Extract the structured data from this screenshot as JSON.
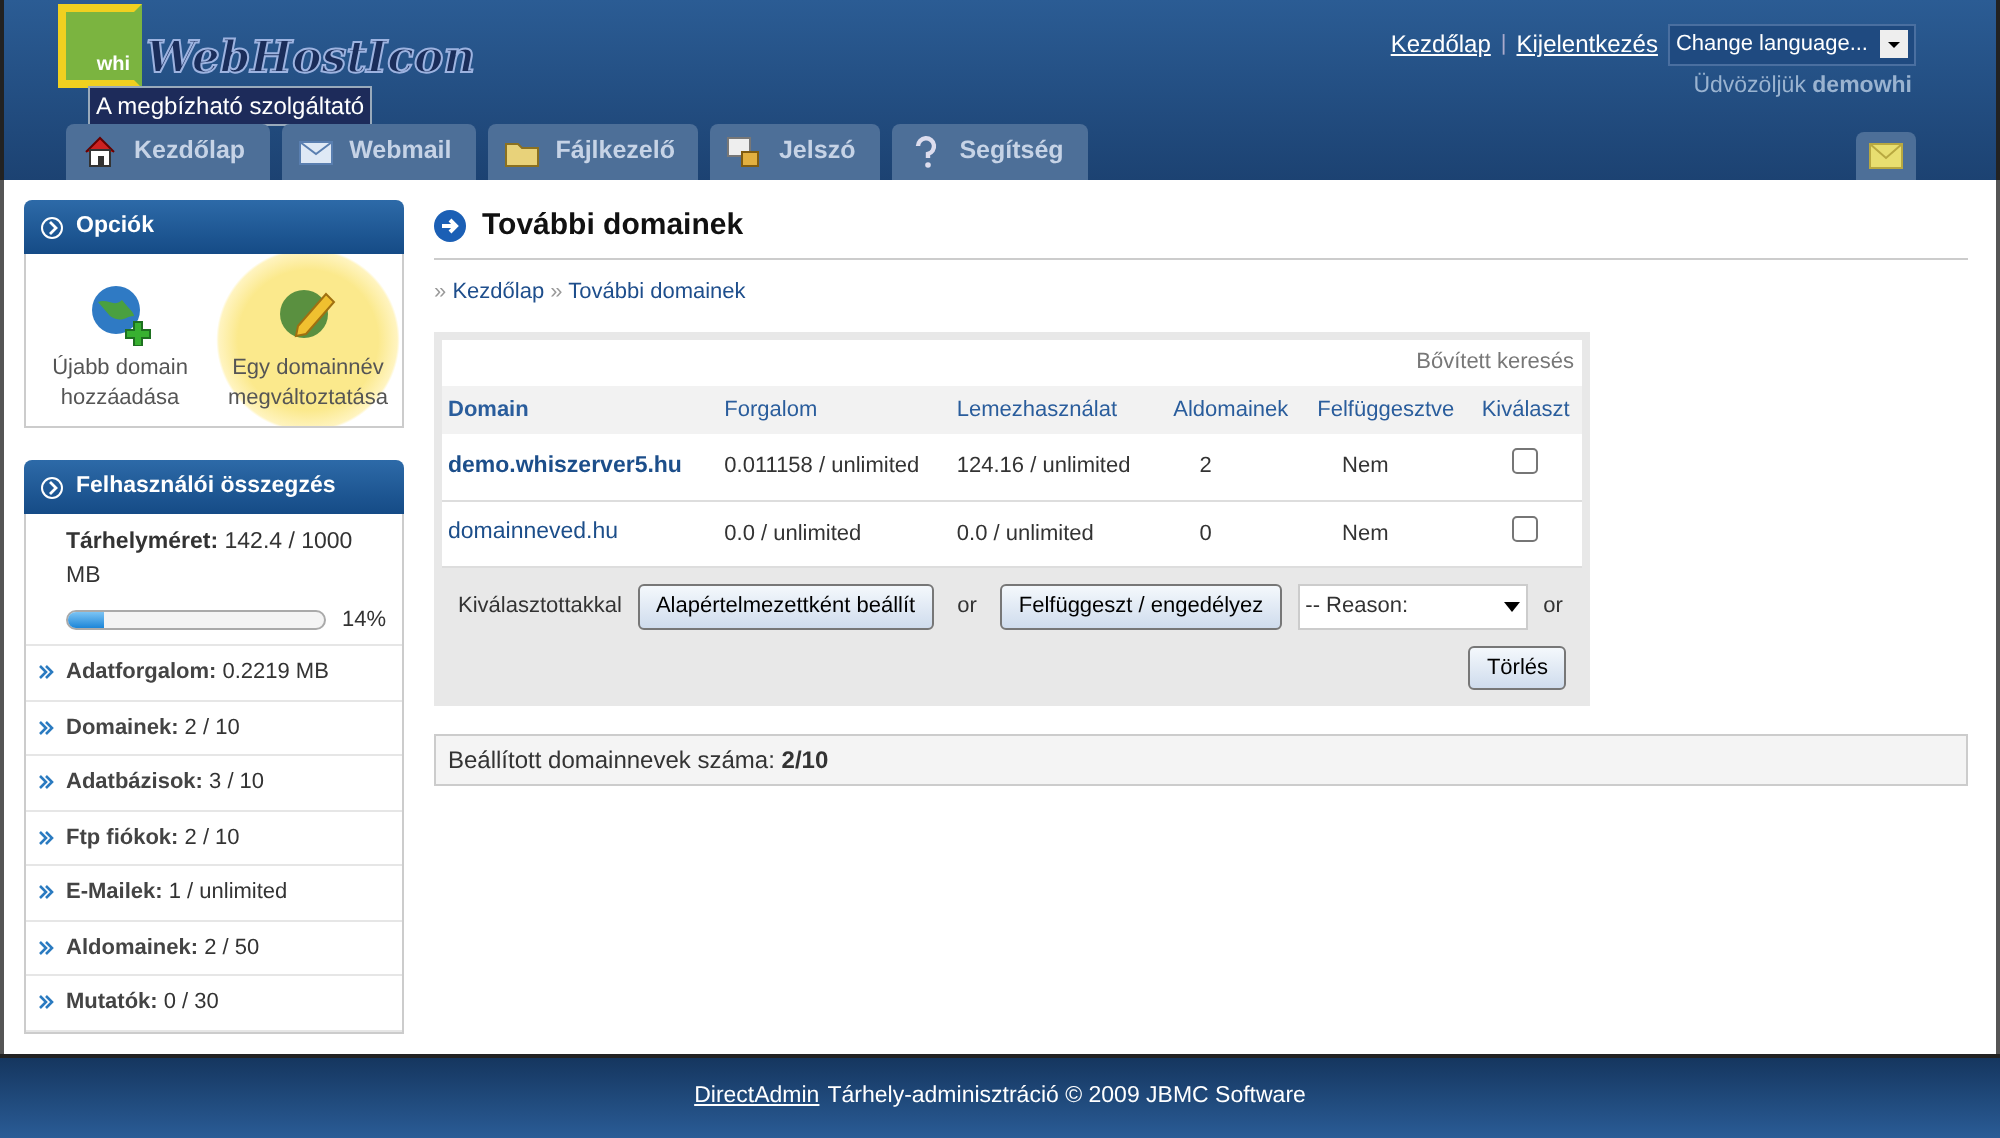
{
  "header": {
    "logo": {
      "badge": "whi",
      "name": "WebHostIcon",
      "slogan": "A megbízható szolgáltató"
    },
    "top_links": [
      "Kezdőlap",
      "Kijelentkezés"
    ],
    "separator": "|",
    "language_select": "Change language...",
    "welcome": {
      "text": "Üdvözöljük",
      "user": "demowhi"
    }
  },
  "tabs": [
    {
      "label": "Kezdőlap",
      "kind": "home"
    },
    {
      "label": "Webmail",
      "kind": "mail"
    },
    {
      "label": "Fájlkezelő",
      "kind": "folder"
    },
    {
      "label": "Jelszó",
      "kind": "key"
    },
    {
      "label": "Segítség",
      "kind": "help"
    }
  ],
  "sidebar": {
    "options": {
      "title": "Opciók",
      "items": [
        {
          "label": "Újabb domain hozzáadása",
          "kind": "add",
          "highlighted": false
        },
        {
          "label": "Egy domainnév megváltoztatása",
          "kind": "edit",
          "highlighted": true
        }
      ]
    },
    "summary": {
      "title": "Felhasználói összegzés",
      "disk": {
        "label": "Tárhelyméret:",
        "value": "142.4 / 1000 MB",
        "level": 0.14,
        "percent": "14%"
      },
      "rows": [
        {
          "label": "Adatforgalom:",
          "value": "0.2219 MB"
        },
        {
          "label": "Domainek:",
          "value": "2 / 10"
        },
        {
          "label": "Adatbázisok:",
          "value": "3 / 10"
        },
        {
          "label": "Ftp fiókok:",
          "value": "2 / 10"
        },
        {
          "label": "E-Mailek:",
          "value": "1 / unlimited"
        },
        {
          "label": "Aldomainek:",
          "value": "2 / 50"
        },
        {
          "label": "Mutatók:",
          "value": "0 / 30"
        }
      ]
    }
  },
  "main": {
    "title": "További domainek",
    "breadcrumb_separator": "»",
    "breadcrumb": [
      "Kezdőlap",
      "További domainek"
    ],
    "advanced_search": "Bővített keresés",
    "table": {
      "columns": [
        "Domain",
        "Forgalom",
        "Lemezhasználat",
        "Aldomainek",
        "Felfüggesztve",
        "Kiválaszt"
      ],
      "rows": [
        {
          "domain": "demo.whiszerver5.hu",
          "default": true,
          "traffic": "0.011158 / unlimited",
          "disk": "124.16 / unlimited",
          "subdomains": "2",
          "suspended": "Nem",
          "checked": false
        },
        {
          "domain": "domainneved.hu",
          "default": false,
          "traffic": "0.0 / unlimited",
          "disk": "0.0 / unlimited",
          "subdomains": "0",
          "suspended": "Nem",
          "checked": false
        }
      ]
    },
    "actions": {
      "label": "Kiválasztottakkal",
      "set_default": "Alapértelmezettként beállít",
      "or_1": "or",
      "suspend": "Felfüggeszt / engedélyez",
      "reason": "-- Reason:",
      "or_2": "or",
      "delete": "Törlés"
    },
    "count": "Beállított domainnevek száma: **2/10**"
  },
  "footer": {
    "link": "DirectAdmin",
    "text": "Tárhely-adminisztráció © 2009 JBMC Software"
  }
}
